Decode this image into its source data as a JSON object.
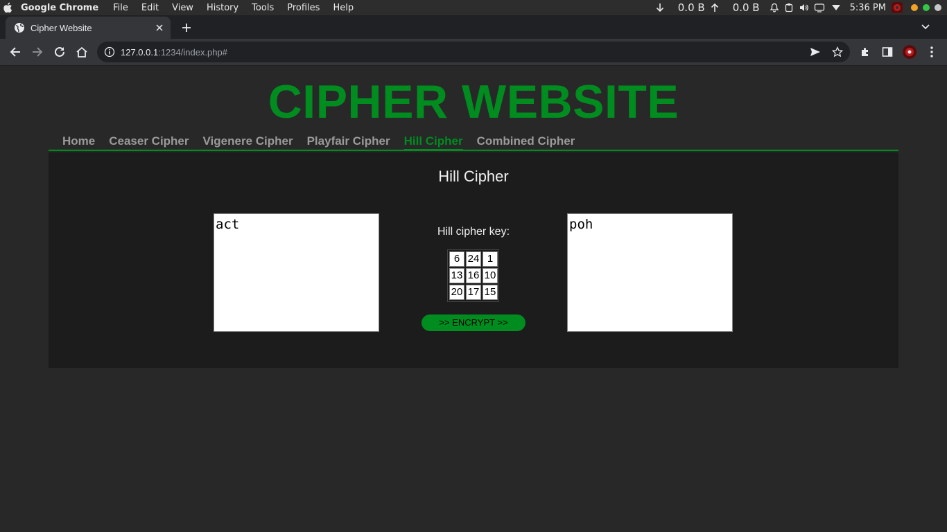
{
  "menubar": {
    "items": [
      "Google Chrome",
      "File",
      "Edit",
      "View",
      "History",
      "Tools",
      "Profiles",
      "Help"
    ],
    "net_down": "0.0 B",
    "net_up": "0.0 B",
    "clock": "5:36 PM"
  },
  "tab": {
    "title": "Cipher Website"
  },
  "toolbar": {
    "url_host": "127.0.0.1",
    "url_rest": ":1234/index.php#"
  },
  "site": {
    "title": "CIPHER WEBSITE",
    "nav": [
      "Home",
      "Ceaser Cipher",
      "Vigenere Cipher",
      "Playfair Cipher",
      "Hill Cipher",
      "Combined Cipher"
    ],
    "active_nav": "Hill Cipher"
  },
  "panel": {
    "title": "Hill Cipher",
    "input_text": "act",
    "key_label": "Hill cipher key:",
    "key": [
      [
        "6",
        "24",
        "1"
      ],
      [
        "13",
        "16",
        "10"
      ],
      [
        "20",
        "17",
        "15"
      ]
    ],
    "button_label": ">> ENCRYPT >>",
    "output_text": "poh"
  },
  "colors": {
    "accent": "#008c1f",
    "page_bg": "#282828",
    "panel_bg": "#1c1c1c"
  }
}
